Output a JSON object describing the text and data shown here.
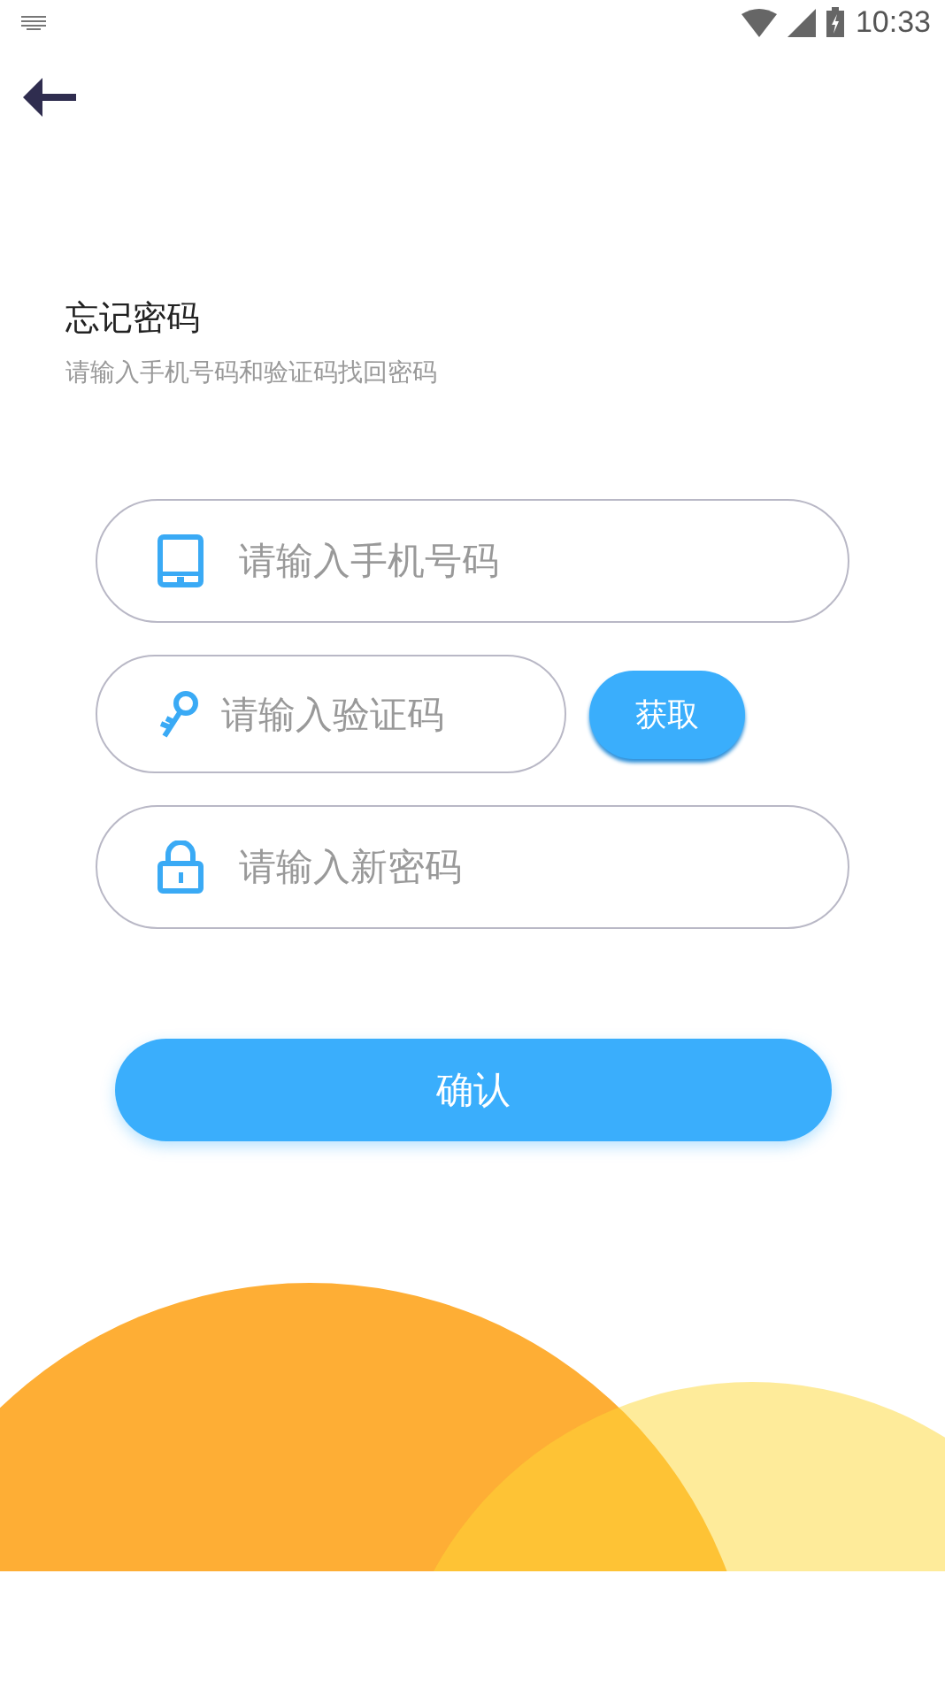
{
  "status_bar": {
    "time": "10:33"
  },
  "heading": {
    "title": "忘记密码",
    "subtitle": "请输入手机号码和验证码找回密码"
  },
  "fields": [
    {
      "kind": "phone",
      "placeholder": "请输入手机号码"
    },
    {
      "kind": "code",
      "placeholder": "请输入验证码",
      "button": "获取"
    },
    {
      "kind": "password",
      "placeholder": "请输入新密码"
    }
  ],
  "confirm_button": "确认"
}
